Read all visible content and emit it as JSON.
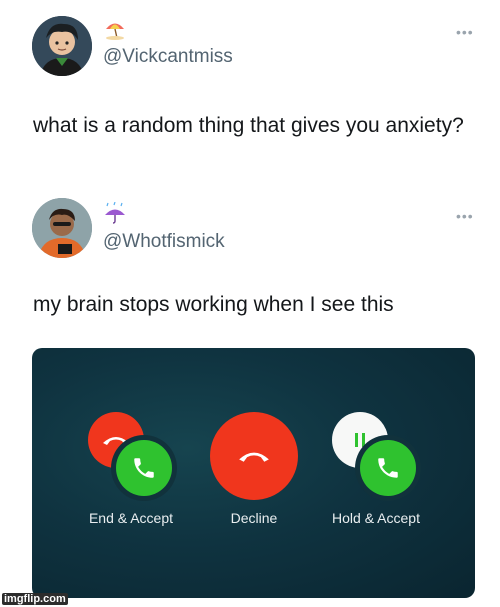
{
  "tweet1": {
    "handle": "@Vickcantmiss",
    "text": "what is a random thing that gives you anxiety?",
    "options_label": "•••"
  },
  "tweet2": {
    "handle": "@Whotfismick",
    "text": "my brain stops working when I see this",
    "options_label": "•••"
  },
  "call_screen": {
    "buttons": [
      {
        "label": "End & Accept"
      },
      {
        "label": "Decline"
      },
      {
        "label": "Hold & Accept"
      }
    ]
  },
  "icons": {
    "tweet1_emoji": "umbrella-on-ground-icon",
    "tweet2_emoji": "umbrella-with-rain-icon",
    "end_call": "phone-hangup-icon",
    "accept_call": "phone-icon",
    "hold": "pause-icon"
  },
  "colors": {
    "decline_red": "#f0361d",
    "accept_green": "#2fc22f",
    "hold_white": "#f7f8f7",
    "panel_bg": "#0f3340"
  },
  "watermark": "imgflip.com"
}
